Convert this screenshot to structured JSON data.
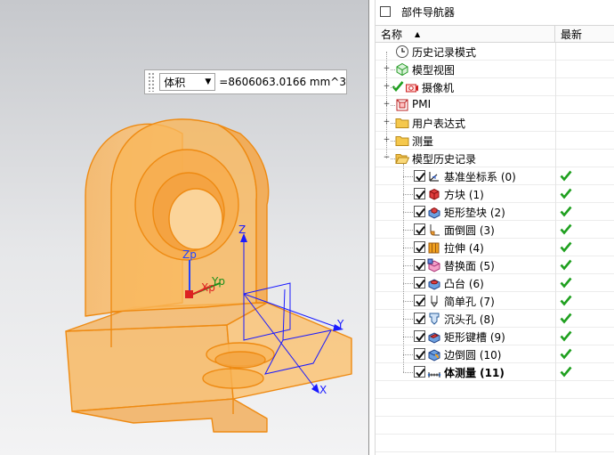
{
  "measure": {
    "type": "体积",
    "value": "=8606063.0166 mm^3"
  },
  "axes": {
    "wcs": {
      "x": "X",
      "y": "Y",
      "z": "Z"
    },
    "part": {
      "x": "Xp",
      "y": "Yp",
      "z": "Zp"
    }
  },
  "navigator": {
    "title": "部件导航器",
    "columns": {
      "name": "名称",
      "latest": "最新"
    },
    "top_nodes": [
      {
        "label": "历史记录模式",
        "icon": "clock-icon"
      },
      {
        "label": "模型视图",
        "icon": "model-views-icon"
      },
      {
        "label": "摄像机",
        "icon": "camera-icon"
      },
      {
        "label": "PMI",
        "icon": "pmi-icon"
      },
      {
        "label": "用户表达式",
        "icon": "folder-icon"
      },
      {
        "label": "测量",
        "icon": "folder-icon"
      },
      {
        "label": "模型历史记录",
        "icon": "folder-open-icon"
      }
    ],
    "features": [
      {
        "label": "基准坐标系 (0)",
        "icon": "datum-csys-icon",
        "latest": true
      },
      {
        "label": "方块 (1)",
        "icon": "block-icon",
        "latest": true
      },
      {
        "label": "矩形垫块 (2)",
        "icon": "rect-pad-icon",
        "latest": true
      },
      {
        "label": "面倒圆 (3)",
        "icon": "face-blend-icon",
        "latest": true
      },
      {
        "label": "拉伸 (4)",
        "icon": "extrude-icon",
        "latest": true
      },
      {
        "label": "替换面 (5)",
        "icon": "replace-face-icon",
        "latest": true
      },
      {
        "label": "凸台 (6)",
        "icon": "boss-icon",
        "latest": true
      },
      {
        "label": "简单孔 (7)",
        "icon": "simple-hole-icon",
        "latest": true
      },
      {
        "label": "沉头孔 (8)",
        "icon": "counterbore-hole-icon",
        "latest": true
      },
      {
        "label": "矩形键槽 (9)",
        "icon": "rect-slot-icon",
        "latest": true
      },
      {
        "label": "边倒圆 (10)",
        "icon": "edge-blend-icon",
        "latest": true
      },
      {
        "label": "体测量 (11)",
        "icon": "body-measure-icon",
        "latest": true
      }
    ]
  },
  "colors": {
    "part_fill": "#f8b152",
    "part_edge": "#ee8a12",
    "csys_blue": "#1a1aff",
    "check_green": "#1fa01f"
  }
}
